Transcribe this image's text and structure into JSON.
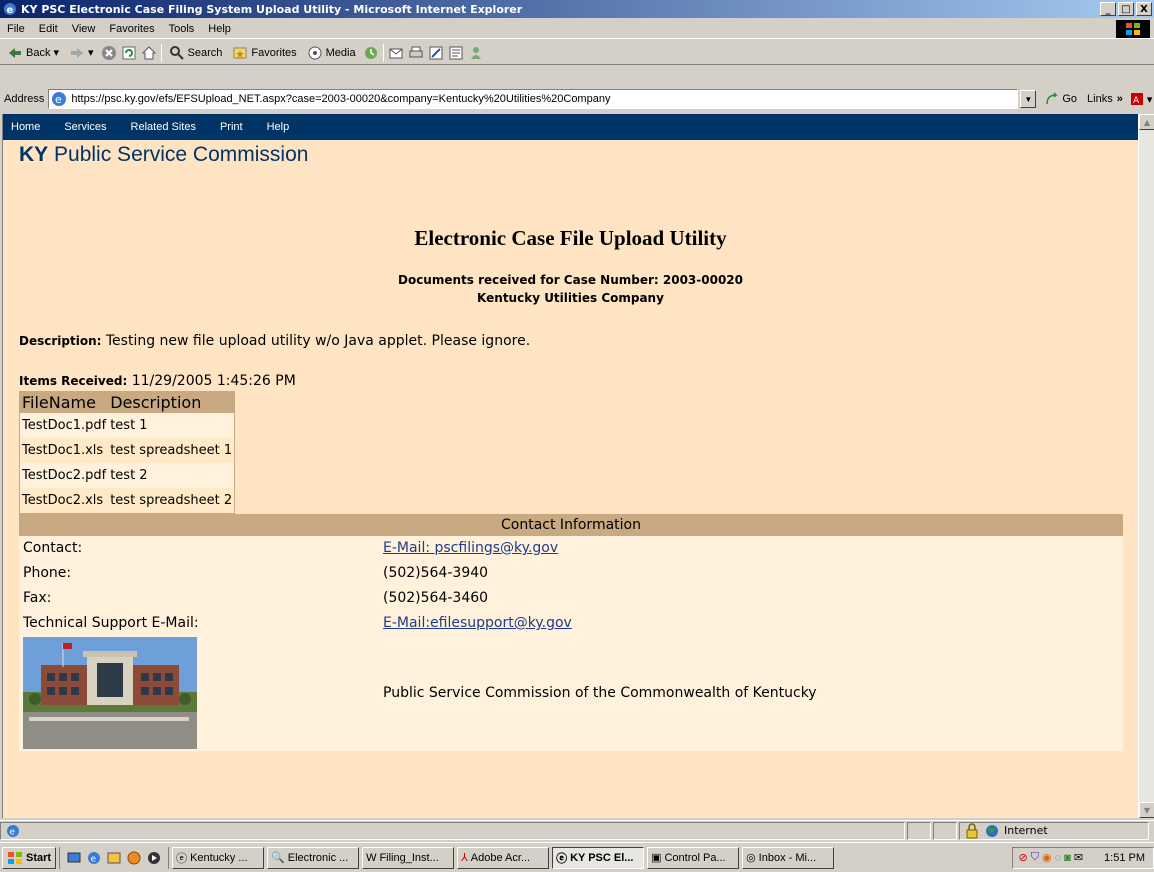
{
  "window": {
    "title": "KY PSC Electronic Case Filing System Upload Utility - Microsoft Internet Explorer",
    "buttons": [
      "_",
      "□",
      "X"
    ]
  },
  "menu": [
    "File",
    "Edit",
    "View",
    "Favorites",
    "Tools",
    "Help"
  ],
  "toolbar": {
    "back": "Back",
    "search": "Search",
    "favorites": "Favorites",
    "media": "Media"
  },
  "address": {
    "label": "Address",
    "url": "https://psc.ky.gov/efs/EFSUpload_NET.aspx?case=2003-00020&company=Kentucky%20Utilities%20Company",
    "go": "Go",
    "links": "Links"
  },
  "sitenav": [
    "Home",
    "Services",
    "Related Sites",
    "Print",
    "Help"
  ],
  "site": {
    "title_bold": "KY",
    "title_rest": "Public Service Commission"
  },
  "page": {
    "heading": "Electronic Case File Upload Utility",
    "received_line": "Documents received for Case Number: 2003-00020",
    "company": "Kentucky Utilities Company",
    "description_label": "Description:",
    "description": "Testing new file upload utility w/o Java applet. Please ignore.",
    "items_label": "Items Received:",
    "items_time": "11/29/2005 1:45:26 PM"
  },
  "files": {
    "headers": [
      "FileName",
      "Description"
    ],
    "rows": [
      [
        "TestDoc1.pdf",
        "test 1"
      ],
      [
        "TestDoc1.xls",
        "test spreadsheet 1"
      ],
      [
        "TestDoc2.pdf",
        "test 2"
      ],
      [
        "TestDoc2.xls",
        "test spreadsheet 2"
      ]
    ]
  },
  "contact": {
    "header": "Contact Information",
    "rows": [
      {
        "label": "Contact:",
        "value": "E-Mail: pscfilings@ky.gov"
      },
      {
        "label": "Phone:",
        "value": "(502)564-3940"
      },
      {
        "label": "Fax:",
        "value": "(502)564-3460"
      },
      {
        "label": "Technical Support E-Mail:",
        "value": "E-Mail:efilesupport@ky.gov"
      }
    ],
    "caption": "Public Service Commission of the Commonwealth of Kentucky"
  },
  "status": {
    "zone": "Internet"
  },
  "taskbar": {
    "start": "Start",
    "buttons": [
      "Kentucky ...",
      "Electronic ...",
      "Filing_Inst...",
      "Adobe Acr...",
      "KY PSC El...",
      "Control Pa...",
      "Inbox - Mi..."
    ],
    "clock": "1:51 PM"
  }
}
